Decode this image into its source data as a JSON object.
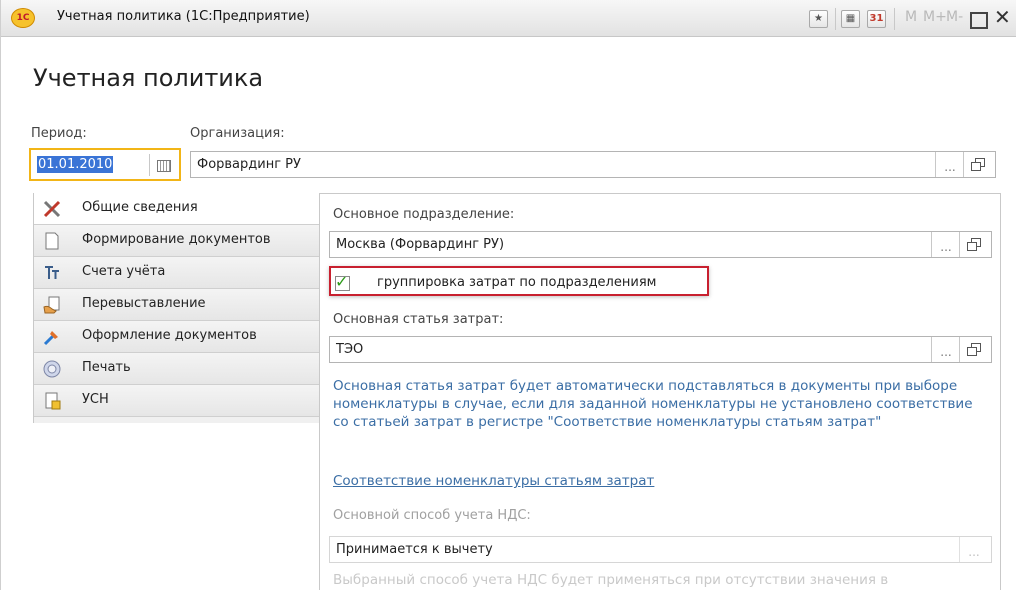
{
  "window": {
    "title": "Учетная политика  (1С:Предприятие)",
    "logo_text": "1С",
    "toolbar": {
      "m": "M",
      "m_plus": "M+",
      "m_minus": "M-",
      "calendar_day": "31"
    }
  },
  "form": {
    "heading": "Учетная политика",
    "period": {
      "label": "Период:",
      "value": "01.01.2010"
    },
    "organization": {
      "label": "Организация:",
      "value": "Форвардинг РУ"
    }
  },
  "tabs": [
    {
      "label": "Общие сведения",
      "icon": "tools-icon",
      "active": true
    },
    {
      "label": "Формирование документов",
      "icon": "document-icon"
    },
    {
      "label": "Счета учёта",
      "icon": "accounts-icon"
    },
    {
      "label": "Перевыставление",
      "icon": "reissue-icon"
    },
    {
      "label": "Оформление документов",
      "icon": "design-icon"
    },
    {
      "label": "Печать",
      "icon": "print-icon"
    },
    {
      "label": "УСН",
      "icon": "usn-icon"
    }
  ],
  "panel": {
    "division_label": "Основное подразделение:",
    "division_value": "Москва (Форвардинг РУ)",
    "group_checkbox_label": "группировка затрат по подразделениям",
    "group_checkbox_checked": true,
    "cost_item_label": "Основная статья затрат:",
    "cost_item_value": "ТЭО",
    "info_text": "Основная статья затрат будет автоматически подставляться в документы при выборе номенклатуры в случае, если для заданной номенклатуры не установлено соответствие со статьей затрат в регистре \"Соответствие номенклатуры статьям затрат\"",
    "link_text": "Соответствие номенклатуры статьям затрат",
    "vat_label": "Основной способ учета НДС:",
    "vat_value": "Принимается к вычету",
    "faded_text": "Выбранный способ учета НДС будет применяться при отсутствии значения в"
  },
  "colors": {
    "accent_link": "#3b6ea5",
    "highlight": "#c8202f",
    "focus": "#f2b517"
  }
}
